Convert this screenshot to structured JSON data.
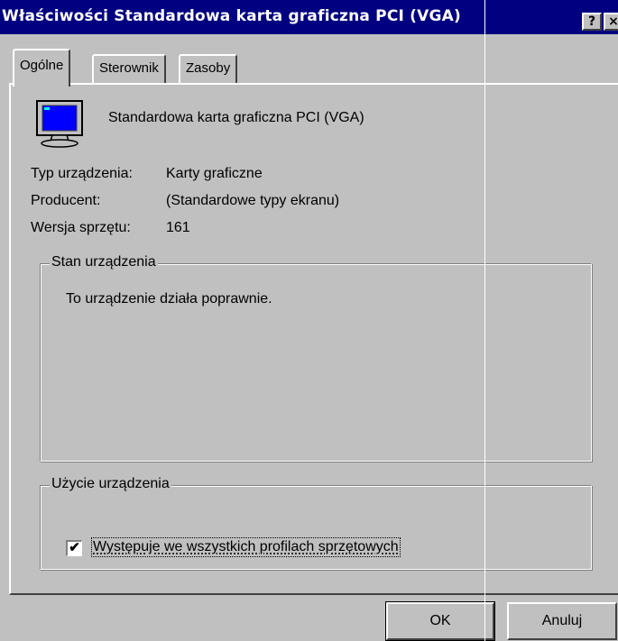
{
  "window": {
    "title": "Właściwości Standardowa karta graficzna PCI (VGA)",
    "help_button": "?",
    "close_button": "×"
  },
  "tabs": [
    {
      "label": "Ogólne",
      "active": true
    },
    {
      "label": "Sterownik",
      "active": false
    },
    {
      "label": "Zasoby",
      "active": false
    }
  ],
  "device": {
    "icon": "monitor-icon",
    "name": "Standardowa karta graficzna PCI (VGA)"
  },
  "properties": [
    {
      "label": "Typ urządzenia:",
      "value": "Karty graficzne"
    },
    {
      "label": "Producent:",
      "value": "(Standardowe typy ekranu)"
    },
    {
      "label": "Wersja sprzętu:",
      "value": "161"
    }
  ],
  "status_group": {
    "legend": "Stan urządzenia",
    "text": "To urządzenie działa poprawnie."
  },
  "usage_group": {
    "legend": "Użycie urządzenia",
    "checkbox_checked": true,
    "checkbox_mark": "✔",
    "checkbox_label": "Występuje we wszystkich profilach sprzętowych"
  },
  "buttons": {
    "ok": "OK",
    "cancel": "Anuluj"
  },
  "colors": {
    "titlebar": "#000080",
    "face": "#c0c0c0",
    "monitor_screen": "#0000ff"
  }
}
